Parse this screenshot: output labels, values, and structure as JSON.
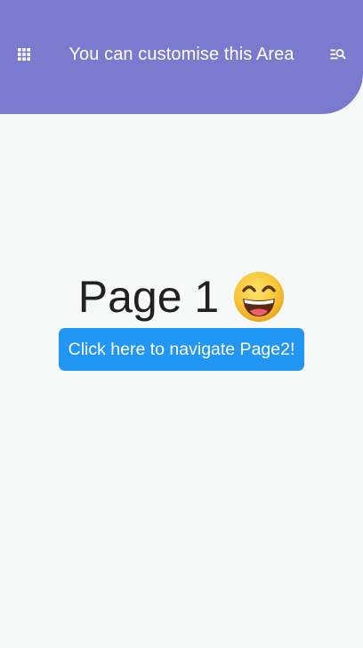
{
  "app_bar": {
    "title": "You can customise this Area",
    "background": "#7a7acf",
    "leading_icon": "apps-grid-icon",
    "trailing_icon": "manage-search-icon"
  },
  "main": {
    "heading": "Page 1",
    "emoji_icon": "grinning-face-emoji",
    "navigate_button_label": "Click here to navigate Page2!",
    "button_color": "#2196f3"
  }
}
